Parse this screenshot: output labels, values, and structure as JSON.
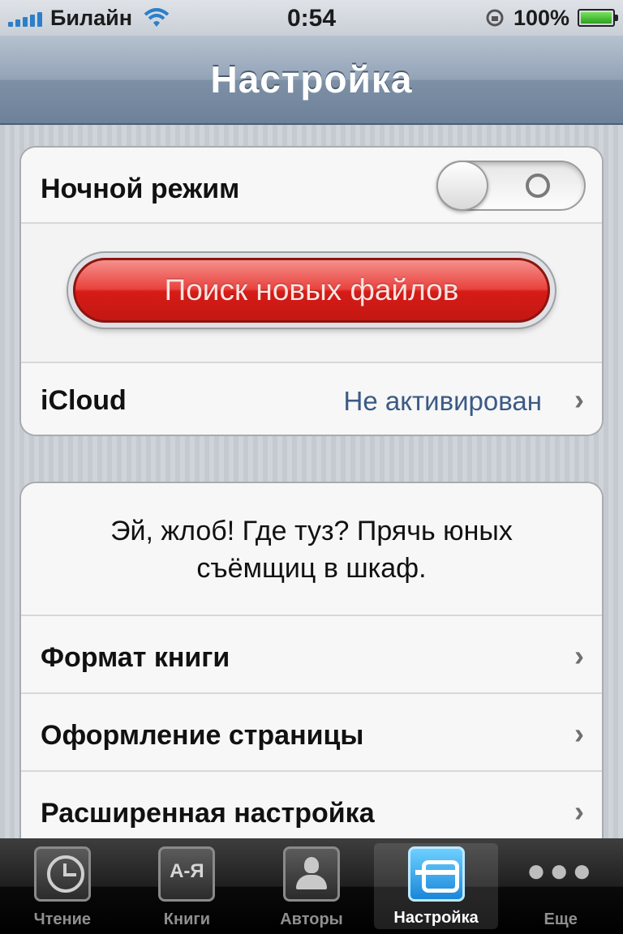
{
  "status_bar": {
    "carrier": "Билайн",
    "time": "0:54",
    "battery_percent": "100%",
    "battery_level": 1.0,
    "signal_bars": 5,
    "icons": [
      "signal-icon",
      "wifi-icon",
      "rotation-lock-icon",
      "battery-icon"
    ]
  },
  "nav": {
    "title": "Настройка"
  },
  "settings": {
    "night_mode_label": "Ночной режим",
    "night_mode_on": false,
    "search_button_label": "Поиск новых файлов",
    "icloud_label": "iCloud",
    "icloud_value": "Не активирован"
  },
  "sample": {
    "line1": "Эй, жлоб! Где туз? Прячь юных",
    "line2": "съёмщиц в шкаф."
  },
  "menu": {
    "book_format": "Формат книги",
    "page_design": "Оформление страницы",
    "advanced": "Расширенная настройка"
  },
  "tabs": [
    {
      "label": "Чтение",
      "icon": "clock-icon",
      "active": false
    },
    {
      "label": "Книги",
      "icon": "az-books-icon",
      "icon_text": "А-Я",
      "active": false
    },
    {
      "label": "Авторы",
      "icon": "person-icon",
      "active": false
    },
    {
      "label": "Настройка",
      "icon": "gear-icon",
      "active": true
    },
    {
      "label": "Еще",
      "icon": "more-icon",
      "active": false
    }
  ],
  "colors": {
    "nav_bar": "#7d90a6",
    "search_button": "#e0302a",
    "icloud_value": "#3b5a85",
    "active_tab": "#1a86d9"
  }
}
